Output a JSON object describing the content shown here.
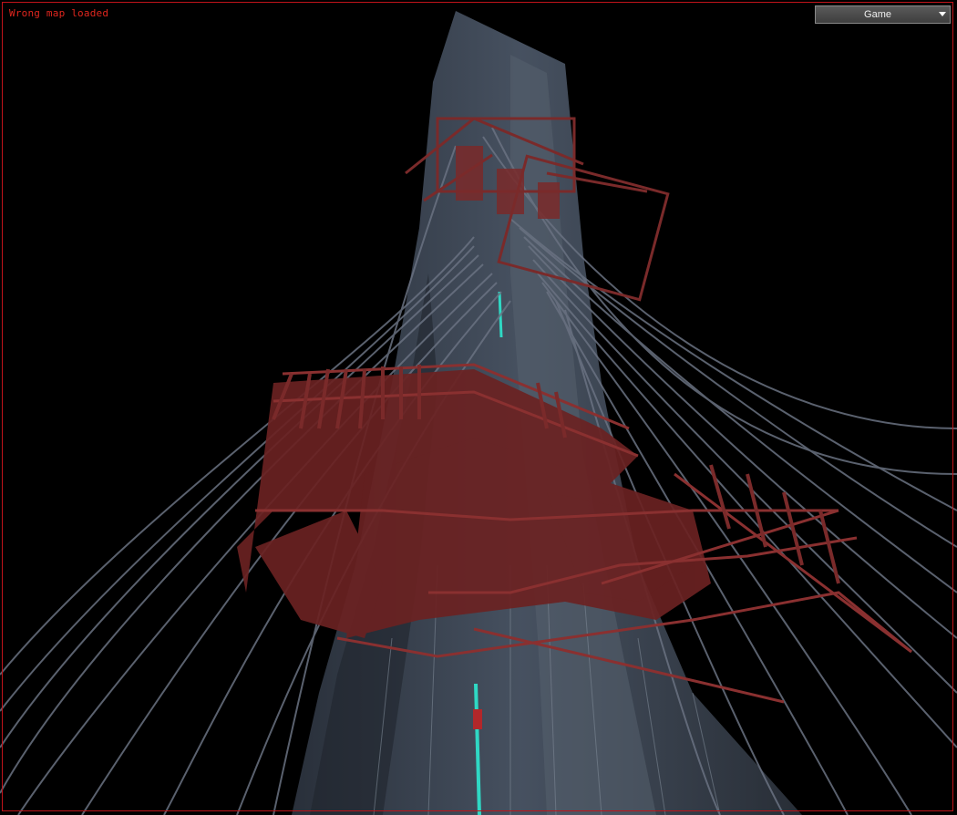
{
  "viewport": {
    "status_text": "Wrong map loaded",
    "scene_name": "3d-scene-tower",
    "colors": {
      "background": "#000000",
      "frame": "#c0141a",
      "status_text": "#e0261e",
      "tower": "#3a4350",
      "scaffold": "#7a2a2a",
      "cables": "#6a7282",
      "accent_light": "#2fd8c4"
    }
  },
  "mode_select": {
    "selected": "Game"
  }
}
